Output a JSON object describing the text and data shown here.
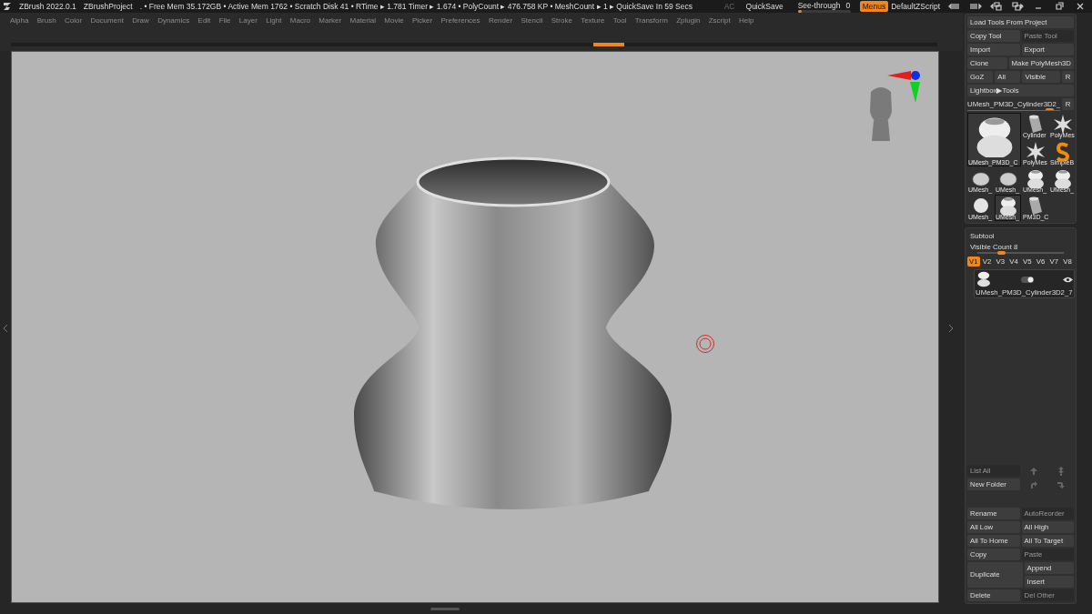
{
  "title_bar": {
    "app_title": "ZBrush 2022.0.1",
    "project": "ZBrushProject",
    "status": ". • Free Mem 35.172GB • Active Mem 1762 • Scratch Disk 41 •  RTime ▸ 1.781 Timer ▸ 1.674 • PolyCount ▸ 476.758 KP  • MeshCount ▸ 1  ▸ QuickSave In 59 Secs",
    "ac_button": "AC",
    "quicksave_button": "QuickSave",
    "see_through": {
      "label": "See-through",
      "value": "0",
      "level": 0.08
    },
    "menus_toggle": {
      "label": "Menus",
      "on": true
    },
    "script": "DefaultZScript"
  },
  "menu_bar": {
    "items": [
      "Alpha",
      "Brush",
      "Color",
      "Document",
      "Draw",
      "Dynamics",
      "Edit",
      "File",
      "Layer",
      "Light",
      "Macro",
      "Marker",
      "Material",
      "Movie",
      "Picker",
      "Preferences",
      "Render",
      "Stencil",
      "Stroke",
      "Texture",
      "Tool",
      "Transform",
      "Zplugin",
      "Zscript",
      "Help"
    ]
  },
  "tool_palette": {
    "rows": [
      [
        {
          "label": "Load Tools From Project",
          "disabled": false,
          "kind": "button"
        }
      ],
      [
        {
          "label": "Copy Tool",
          "disabled": false,
          "kind": "button"
        },
        {
          "label": "Paste Tool",
          "disabled": true,
          "kind": "button"
        }
      ],
      [
        {
          "label": "Import",
          "disabled": false,
          "kind": "button"
        },
        {
          "label": "Export",
          "disabled": false,
          "kind": "button"
        }
      ],
      [
        {
          "label": "Clone",
          "disabled": false,
          "kind": "button"
        },
        {
          "label": "Make PolyMesh3D",
          "disabled": false,
          "kind": "wide"
        }
      ],
      [
        {
          "label": "GoZ",
          "disabled": false,
          "kind": "button"
        },
        {
          "label": "All",
          "disabled": false,
          "kind": "button"
        },
        {
          "label": "Visible",
          "disabled": false,
          "kind": "wide"
        },
        {
          "label": "R",
          "disabled": false,
          "kind": "small"
        }
      ],
      [
        {
          "label": "Lightbox▶Tools",
          "disabled": false,
          "kind": "button"
        }
      ]
    ],
    "current_tool": {
      "name": "UMesh_PM3D_Cylinder3D2_",
      "level": 0.93,
      "r_button": "R"
    },
    "thumbnails": [
      {
        "label": "UMesh_PM3D_C",
        "kind": "vase",
        "selected": true
      },
      {
        "label": "Cylinder",
        "kind": "cylinder",
        "selected": false
      },
      {
        "label": "PolyMes",
        "kind": "star",
        "selected": false
      },
      {
        "label": "PolyMes",
        "kind": "star",
        "selected": false
      },
      {
        "label": "SimpleB",
        "kind": "brush",
        "selected": false
      },
      {
        "label": "UMesh_",
        "kind": "mesh",
        "selected": false
      },
      {
        "label": "UMesh_",
        "kind": "mesh",
        "selected": false
      },
      {
        "label": "UMesh_",
        "kind": "vase",
        "selected": false
      },
      {
        "label": "UMesh_",
        "kind": "vase",
        "selected": false
      },
      {
        "label": "UMesh_",
        "kind": "sphere",
        "selected": false
      },
      {
        "label": "UMesh_",
        "kind": "vase",
        "selected": true
      },
      {
        "label": "PM3D_C",
        "kind": "cylinder",
        "selected": false
      }
    ]
  },
  "subtool": {
    "title": "Subtool",
    "visible_count": {
      "label": "Visible Count 8",
      "level": 0.27
    },
    "versions": [
      {
        "label": "V1",
        "selected": true
      },
      {
        "label": "V2",
        "selected": false
      },
      {
        "label": "V3",
        "selected": false
      },
      {
        "label": "V4",
        "selected": false
      },
      {
        "label": "V5",
        "selected": false
      },
      {
        "label": "V6",
        "selected": false
      },
      {
        "label": "V7",
        "selected": false
      },
      {
        "label": "V8",
        "selected": false
      }
    ],
    "items": [
      {
        "name": "UMesh_PM3D_Cylinder3D2_7",
        "selected": true,
        "visible": true
      }
    ],
    "list_actions": [
      {
        "label": "List All",
        "disabled": true,
        "kind": "button"
      },
      {
        "kind": "arrow-up",
        "disabled": true
      },
      {
        "kind": "arrow-up-double",
        "disabled": true
      },
      {
        "label": "New Folder",
        "disabled": false,
        "kind": "button"
      },
      {
        "kind": "turn-right",
        "disabled": true
      },
      {
        "kind": "turn-down",
        "disabled": true
      }
    ],
    "actions": [
      {
        "label": "Rename",
        "disabled": false,
        "kind": "button"
      },
      {
        "label": "AutoReorder",
        "disabled": true,
        "kind": "button"
      },
      {
        "label": "All Low",
        "disabled": false,
        "kind": "button"
      },
      {
        "label": "All High",
        "disabled": false,
        "kind": "button"
      },
      {
        "label": "All To Home",
        "disabled": false,
        "kind": "button"
      },
      {
        "label": "All To Target",
        "disabled": false,
        "kind": "button"
      },
      {
        "label": "Copy",
        "disabled": false,
        "kind": "button"
      },
      {
        "label": "Paste",
        "disabled": true,
        "kind": "button"
      }
    ],
    "duplicate_group": {
      "main": {
        "label": "Duplicate",
        "disabled": false,
        "kind": "tall"
      },
      "options": [
        {
          "label": "Append",
          "disabled": false,
          "kind": "button"
        },
        {
          "label": "Insert",
          "disabled": false,
          "kind": "button"
        }
      ]
    },
    "more_actions": [
      {
        "label": "Delete",
        "disabled": false,
        "kind": "button"
      },
      {
        "label": "Del Other",
        "disabled": true,
        "kind": "button"
      }
    ]
  }
}
